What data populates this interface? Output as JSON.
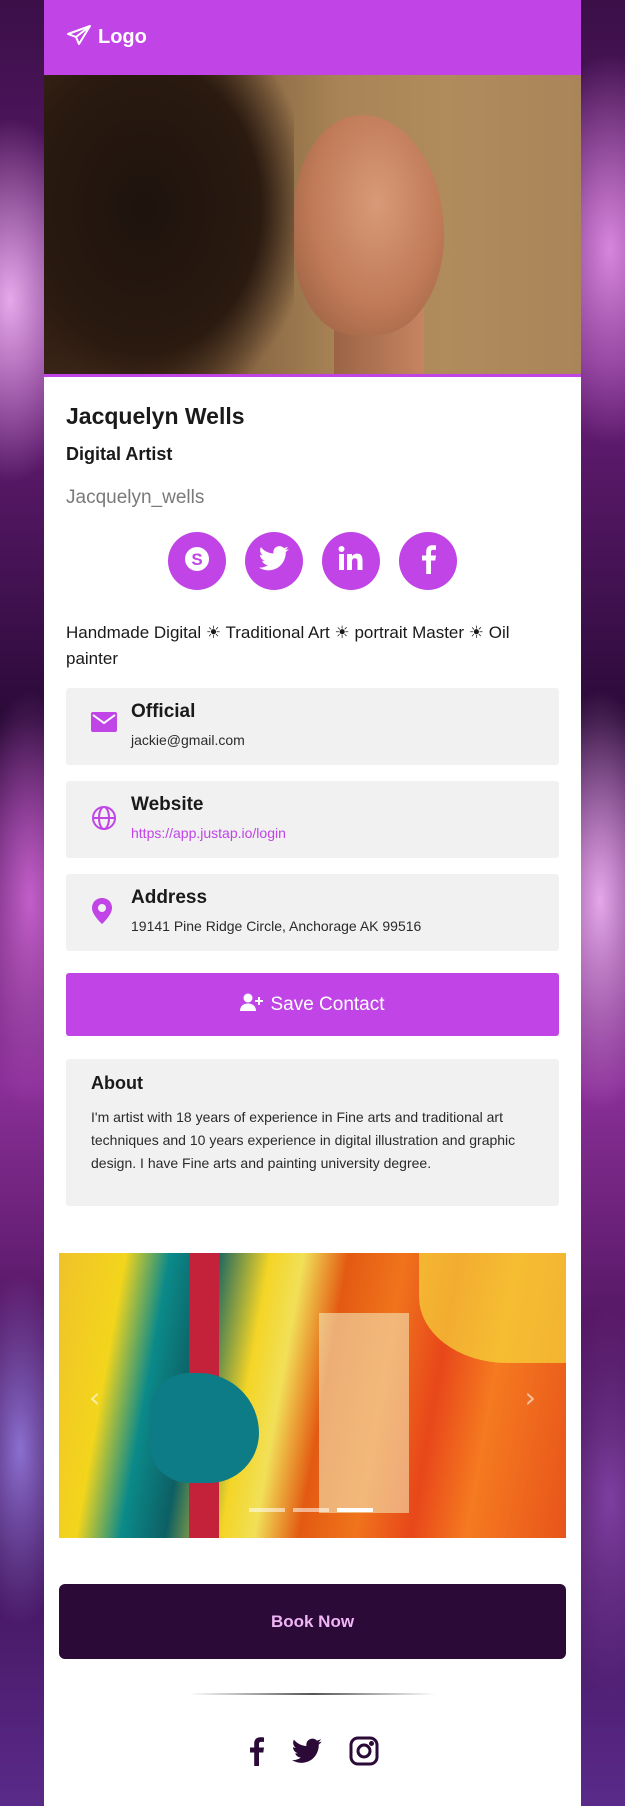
{
  "header": {
    "logo_label": "Logo"
  },
  "profile": {
    "name": "Jacquelyn Wells",
    "title": "Digital Artist",
    "username": "Jacquelyn_wells",
    "bio": "Handmade Digital ☀ Traditional Art ☀ portrait Master ☀ Oil painter"
  },
  "socials": [
    {
      "icon": "skype-icon"
    },
    {
      "icon": "twitter-icon"
    },
    {
      "icon": "linkedin-icon"
    },
    {
      "icon": "facebook-icon"
    }
  ],
  "contacts": {
    "email": {
      "label": "Official",
      "value": "jackie@gmail.com"
    },
    "website": {
      "label": "Website",
      "value": "https://app.justap.io/login"
    },
    "address": {
      "label": "Address",
      "value": "19141 Pine Ridge Circle, Anchorage AK 99516"
    }
  },
  "save_button": {
    "label": "Save Contact"
  },
  "about": {
    "heading": "About",
    "text": "I'm artist with 18 years of experience in Fine arts and traditional art techniques and 10 years experience in digital illustration and graphic design. I have Fine arts and painting university degree."
  },
  "carousel": {
    "slide_count": 3,
    "active_index": 2
  },
  "book_button": {
    "label": "Book Now"
  },
  "colors": {
    "accent": "#c044e6",
    "dark": "#2c0a38",
    "panel": "#f1f1f1"
  }
}
